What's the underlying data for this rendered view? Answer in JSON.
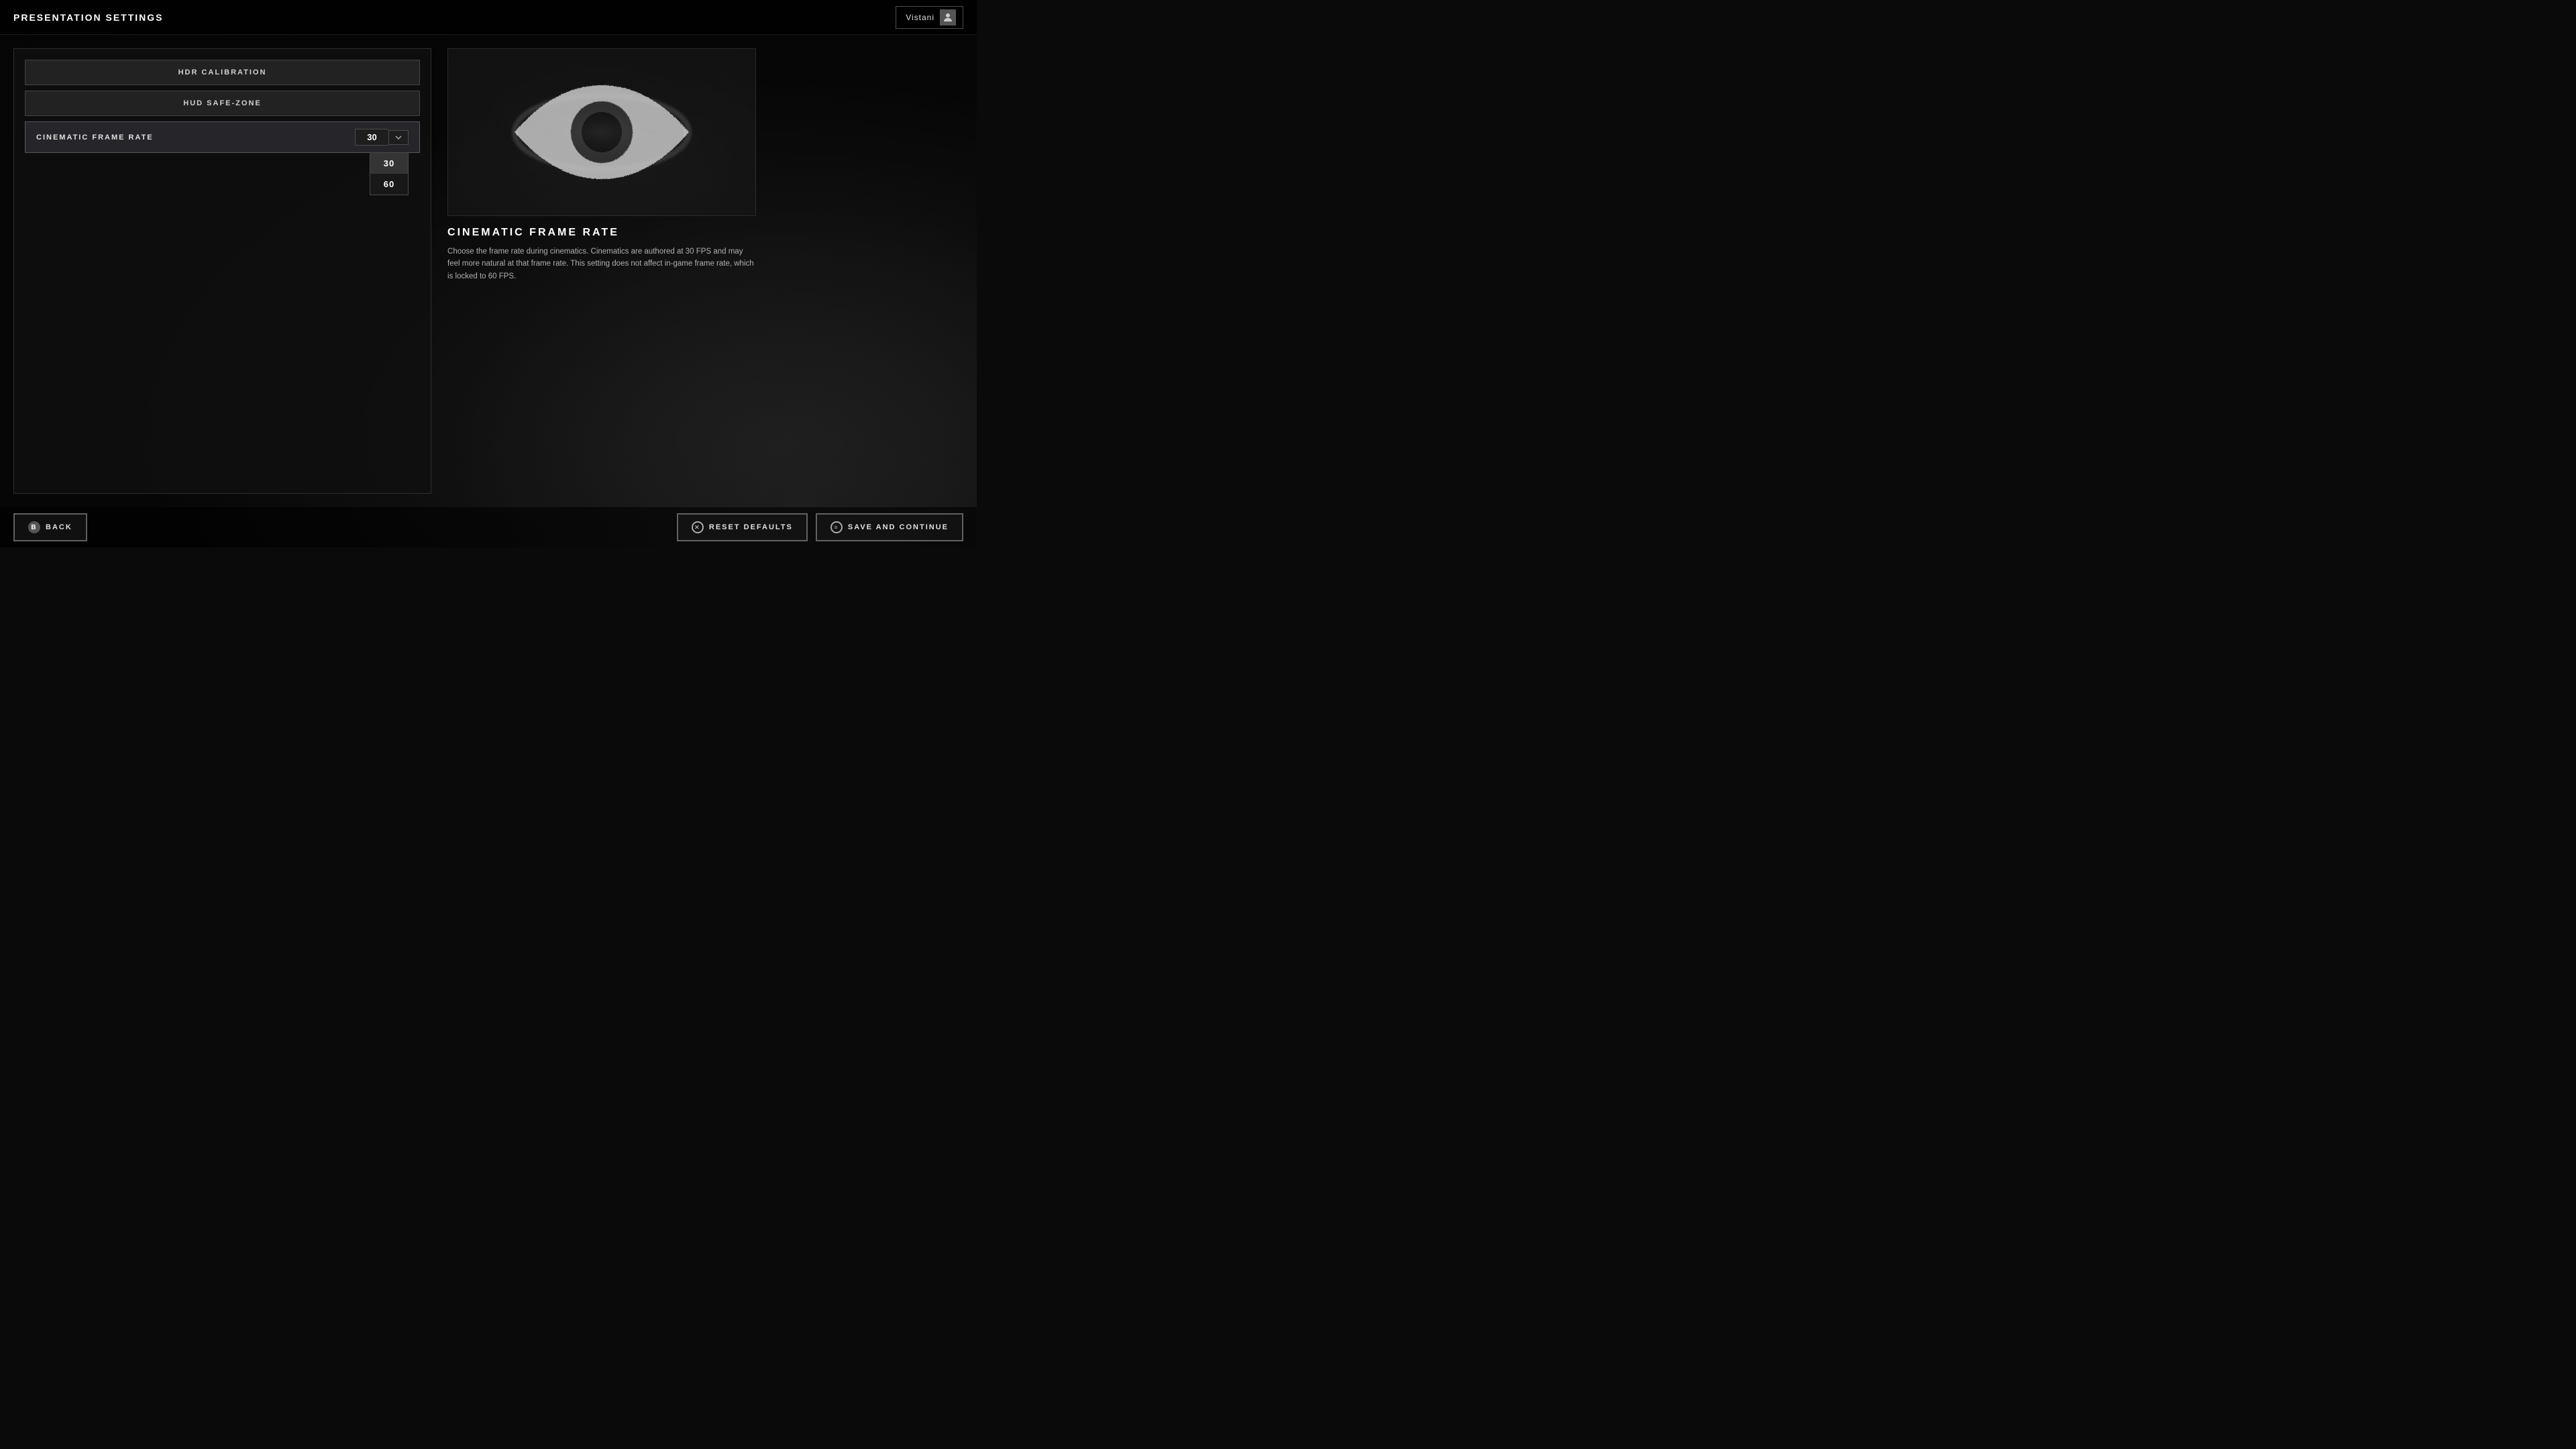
{
  "header": {
    "title": "PRESENTATION SETTINGS",
    "user": {
      "name": "Vistani",
      "icon": "👤"
    }
  },
  "left_panel": {
    "buttons": [
      {
        "label": "HDR CALIBRATION",
        "id": "hdr"
      },
      {
        "label": "HUD SAFE-ZONE",
        "id": "hud"
      }
    ],
    "setting": {
      "label": "CINEMATIC FRAME RATE",
      "current_value": "30",
      "dropdown_open": true,
      "options": [
        {
          "value": "30",
          "active": true
        },
        {
          "value": "60",
          "active": false
        }
      ]
    }
  },
  "right_panel": {
    "preview_alt": "Cinematic Frame Rate Preview - Eye Icon",
    "info_title": "CINEMATIC FRAME RATE",
    "info_description": "Choose the frame rate during cinematics. Cinematics are authored at 30 FPS and may feel more natural at that frame rate. This setting does not affect in-game frame rate, which is locked to 60 FPS."
  },
  "footer": {
    "back_button": "BACK",
    "back_icon": "B",
    "reset_button": "RESET DEFAULTS",
    "reset_icon": "✕",
    "save_button": "SAVE AND CONTINUE",
    "save_icon": "≡"
  }
}
